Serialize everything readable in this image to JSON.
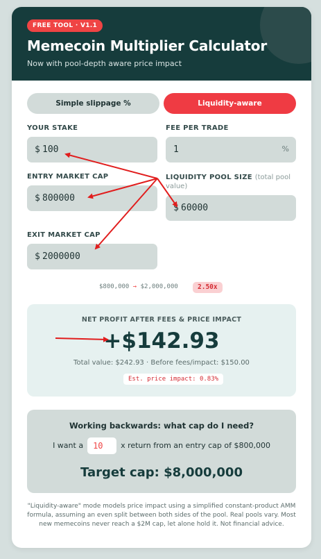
{
  "header": {
    "badge": "FREE TOOL · V1.1",
    "title": "Memecoin Multiplier Calculator",
    "subtitle": "Now with pool-depth aware price impact"
  },
  "mode_toggle": {
    "options": [
      "Simple slippage %",
      "Liquidity-aware"
    ],
    "selected": "Liquidity-aware"
  },
  "fields": {
    "stake": {
      "label": "YOUR STAKE",
      "prefix": "$",
      "value": "100"
    },
    "fee": {
      "label": "FEE PER TRADE",
      "value": "1",
      "suffix": "%"
    },
    "entry_cap": {
      "label": "ENTRY MARKET CAP",
      "prefix": "$",
      "value": "800000"
    },
    "pool_size": {
      "label": "LIQUIDITY POOL SIZE",
      "label_note": "(total pool value)",
      "prefix": "$",
      "value": "60000"
    },
    "exit_cap": {
      "label": "EXIT MARKET CAP",
      "prefix": "$",
      "value": "2000000"
    }
  },
  "summary": {
    "from": "$800,000",
    "arrow": "→",
    "to": "$2,000,000",
    "multiplier": "2.50x"
  },
  "result": {
    "label": "NET PROFIT AFTER FEES & PRICE IMPACT",
    "value": "+$142.93",
    "detail": "Total value: $242.93  ·  Before fees/impact: $150.00",
    "impact": "Est. price impact: 0.83%"
  },
  "backwards": {
    "title": "Working backwards: what cap do I need?",
    "prefix_text": "I want a",
    "multiplier_value": "10",
    "suffix_text": "x return from an entry cap of $800,000",
    "target": "Target cap: $8,000,000"
  },
  "footer": "\"Liquidity-aware\" mode models price impact using a simplified constant-product AMM formula, assuming an even split between both sides of the pool. Real pools vary. Most new memecoins never reach a $2M cap, let alone hold it. Not financial advice.",
  "colors": {
    "header_bg": "#163c3c",
    "accent_red": "#ef3b43",
    "field_bg": "#d2dbd9",
    "result_bg": "#e6f1f0"
  },
  "annotations": {
    "color": "#e11d1d",
    "arrow_count": 5
  }
}
